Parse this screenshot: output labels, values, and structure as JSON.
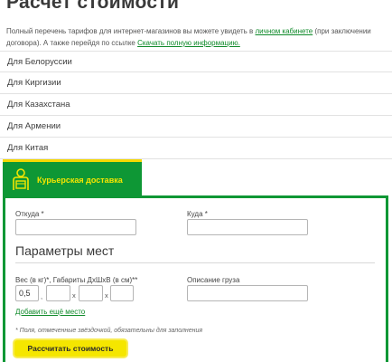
{
  "page": {
    "title": "Расчет стоимости",
    "intro_text": "Полный перечень тарифов для интернет-магазинов вы можете увидеть в ",
    "intro_link1": "личном кабинете",
    "intro_text2": " (при заключении договора). А также перейдя по ссылке ",
    "intro_link2": "Скачать полную информацию."
  },
  "accordion": [
    {
      "label": "Для Белоруссии"
    },
    {
      "label": "Для Киргизии"
    },
    {
      "label": "Для Казахстана"
    },
    {
      "label": "Для Армении"
    },
    {
      "label": "Для Китая"
    }
  ],
  "tab": {
    "label": "Курьерская доставка",
    "icon": "courier-icon"
  },
  "form": {
    "from_label": "Откуда *",
    "from_value": "",
    "to_label": "Куда *",
    "to_value": "",
    "places_title": "Параметры мест",
    "weight_label": "Вес (в кг)*, Габариты ДхШхВ (в см)**",
    "weight_value": "0,5",
    "comma_sep": ",",
    "x_sep": "x",
    "length_value": "",
    "width_value": "",
    "height_value": "",
    "description_label": "Описание груза",
    "description_value": "",
    "add_place_link": "Добавить ещё место",
    "required_note": "* Поля, отмеченные звёздочкой, обязательны для заполнения",
    "calculate_button": "Рассчитать стоимость"
  },
  "colors": {
    "brand_green": "#0e9735",
    "accent_yellow": "#f5e600",
    "link_green": "#0f8a2a"
  }
}
